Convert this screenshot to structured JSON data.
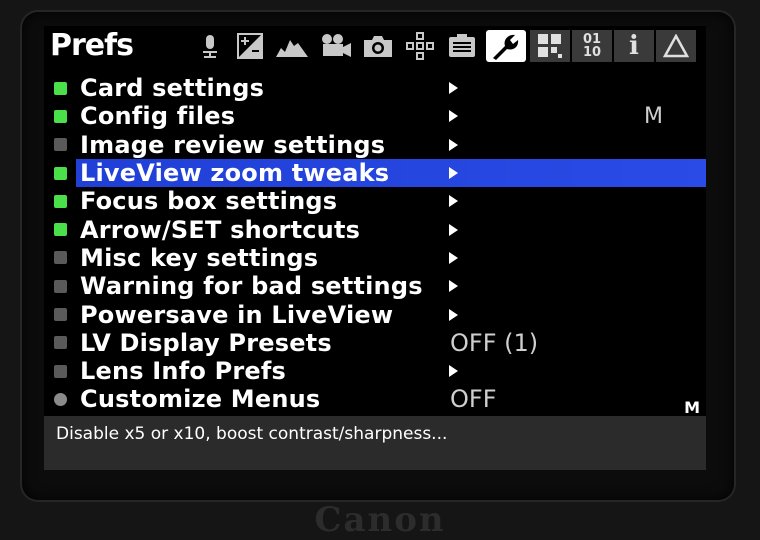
{
  "header": {
    "title": "Prefs",
    "tabs": [
      {
        "icon": "microphone-icon",
        "active": false
      },
      {
        "icon": "exposure-icon",
        "active": false
      },
      {
        "icon": "histogram-icon",
        "active": false
      },
      {
        "icon": "movie-camera-icon",
        "active": false
      },
      {
        "icon": "camera-icon",
        "active": false
      },
      {
        "icon": "focus-points-icon",
        "active": false
      },
      {
        "icon": "display-icon",
        "active": false
      },
      {
        "icon": "wrench-icon",
        "active": true
      },
      {
        "icon": "modules-icon",
        "active": false
      },
      {
        "icon": "debug-binary-icon",
        "label": "01\n10",
        "active": false
      },
      {
        "icon": "info-icon",
        "label": "i",
        "active": false
      },
      {
        "icon": "warning-triangle-icon",
        "active": false
      }
    ]
  },
  "menu": {
    "items": [
      {
        "label": "Card settings",
        "indicator": "green",
        "submenu": true,
        "value": "",
        "flag": ""
      },
      {
        "label": "Config files",
        "indicator": "green",
        "submenu": true,
        "value": "",
        "flag": "M"
      },
      {
        "label": "Image review settings",
        "indicator": "grey",
        "submenu": true,
        "value": "",
        "flag": ""
      },
      {
        "label": "LiveView zoom tweaks",
        "indicator": "green",
        "submenu": true,
        "value": "",
        "flag": "",
        "selected": true
      },
      {
        "label": "Focus box settings",
        "indicator": "green",
        "submenu": true,
        "value": "",
        "flag": ""
      },
      {
        "label": "Arrow/SET shortcuts",
        "indicator": "green",
        "submenu": true,
        "value": "",
        "flag": ""
      },
      {
        "label": "Misc key settings",
        "indicator": "grey",
        "submenu": true,
        "value": "",
        "flag": ""
      },
      {
        "label": "Warning for bad settings",
        "indicator": "grey",
        "submenu": true,
        "value": "",
        "flag": ""
      },
      {
        "label": "Powersave in LiveView",
        "indicator": "grey",
        "submenu": true,
        "value": "",
        "flag": ""
      },
      {
        "label": "LV Display Presets",
        "indicator": "grey",
        "submenu": false,
        "value": "OFF (1)",
        "flag": ""
      },
      {
        "label": "Lens Info Prefs",
        "indicator": "grey",
        "submenu": true,
        "value": "",
        "flag": ""
      },
      {
        "label": "Customize Menus",
        "indicator": "round",
        "submenu": false,
        "value": "OFF",
        "flag": ""
      }
    ]
  },
  "corner_flag": "M",
  "status": {
    "help_text": "Disable x5 or x10, boost contrast/sharpness..."
  },
  "colors": {
    "selection": "#2a4be6",
    "enabled": "#49e04a",
    "disabled": "#5a5a5a"
  }
}
